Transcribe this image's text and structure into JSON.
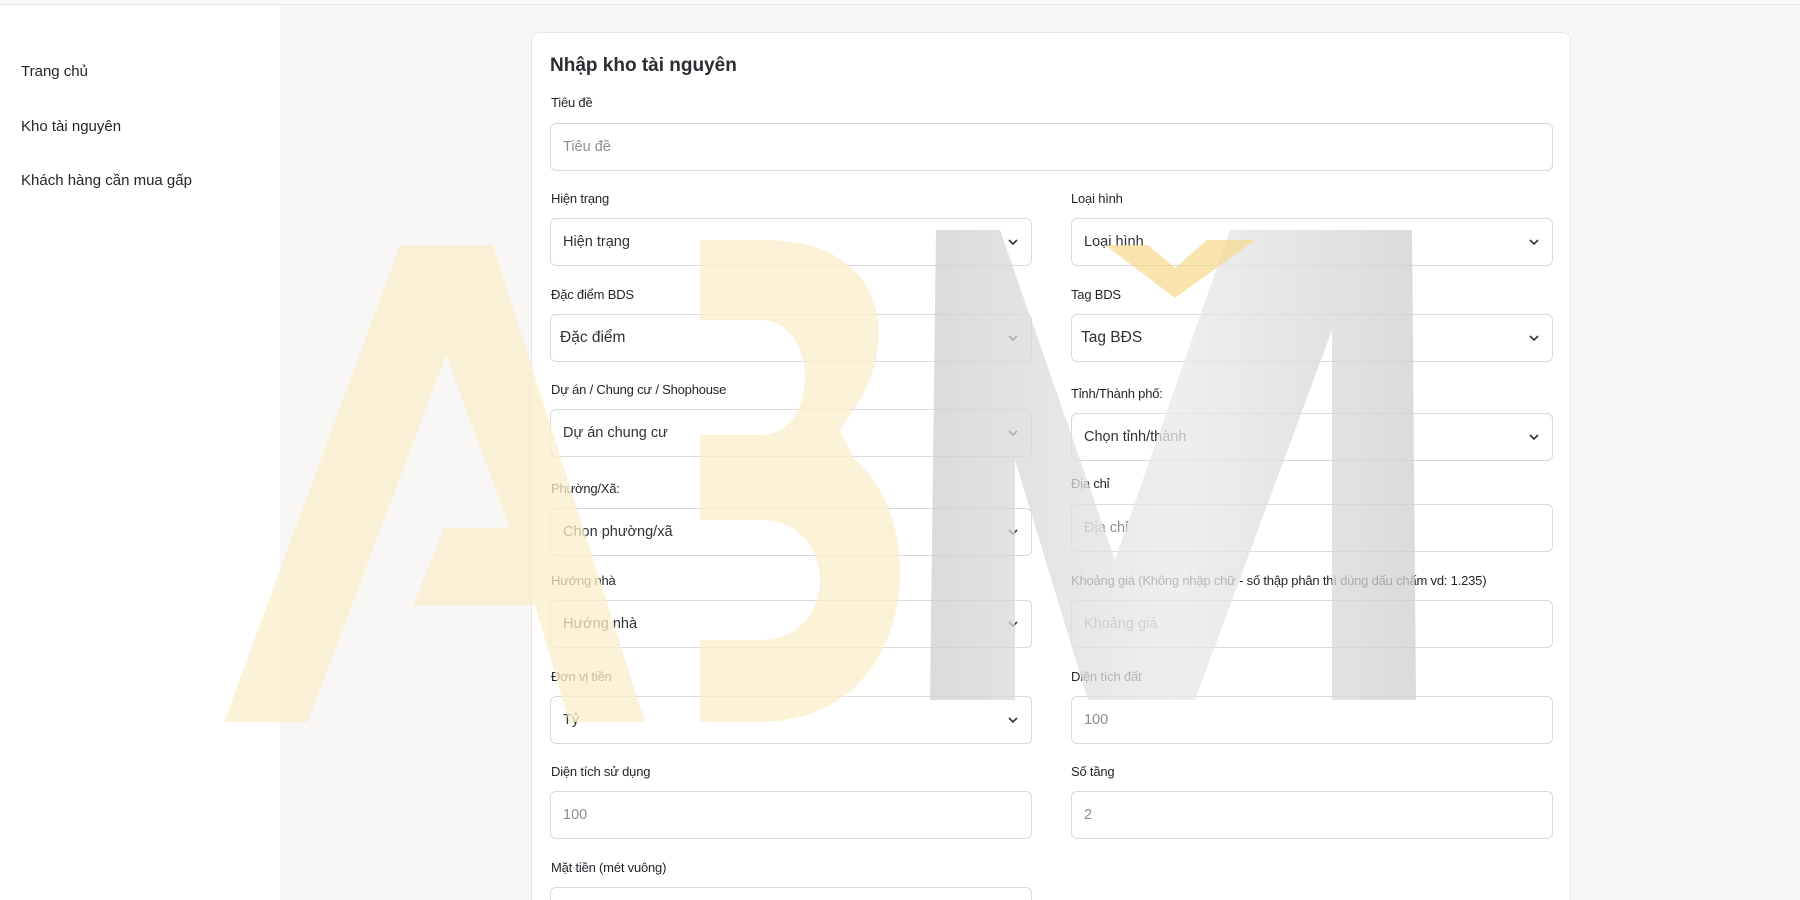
{
  "sidebar": {
    "items": [
      {
        "label": "Trang chủ"
      },
      {
        "label": "Kho tài nguyên"
      },
      {
        "label": "Khách hàng cần mua gấp"
      }
    ]
  },
  "form": {
    "title": "Nhập kho tài nguyên",
    "fields": {
      "tieu_de": {
        "label": "Tiêu đề",
        "placeholder": "Tiêu đề"
      },
      "hien_trang": {
        "label": "Hiện trạng",
        "value": "Hiện trạng"
      },
      "loai_hinh": {
        "label": "Loại hình",
        "value": "Loại hình"
      },
      "dac_diem": {
        "label": "Đặc điểm BDS",
        "value": "Đặc điểm"
      },
      "tag_bds": {
        "label": "Tag BDS",
        "value": "Tag BĐS"
      },
      "du_an": {
        "label": "Dự án / Chung cư / Shophouse",
        "value": "Dự án chung cư"
      },
      "tinh_thanh": {
        "label": "Tỉnh/Thành phố:",
        "value": "Chọn tỉnh/thành"
      },
      "phuong_xa": {
        "label": "Phường/Xã:",
        "value": "Chọn phường/xã"
      },
      "dia_chi": {
        "label": "Địa chỉ",
        "placeholder": "Địa chỉ"
      },
      "huong_nha": {
        "label": "Hướng nhà",
        "value": "Hướng nhà"
      },
      "khoang_gia": {
        "label": "Khoảng giá (Không nhập chữ - số thập phân thì dùng dấu chấm vd: 1.235)",
        "placeholder": "Khoảng giá"
      },
      "don_vi_tien": {
        "label": "Đơn vị tiền",
        "value": "Tỷ"
      },
      "dien_tich_dat": {
        "label": "Diện tích đất",
        "placeholder": "100"
      },
      "dien_tich_su_dung": {
        "label": "Diện tích sử dụng",
        "placeholder": "100"
      },
      "so_tang": {
        "label": "Số tầng",
        "placeholder": "2"
      },
      "mat_tien": {
        "label": "Mặt tiền (mét vuông)"
      }
    }
  },
  "watermark": {
    "text": "ABM",
    "colors": {
      "a": "#fbeecb",
      "b": "#fbeecb",
      "m": "#d8d8d8",
      "accent": "#f6d98a"
    }
  }
}
